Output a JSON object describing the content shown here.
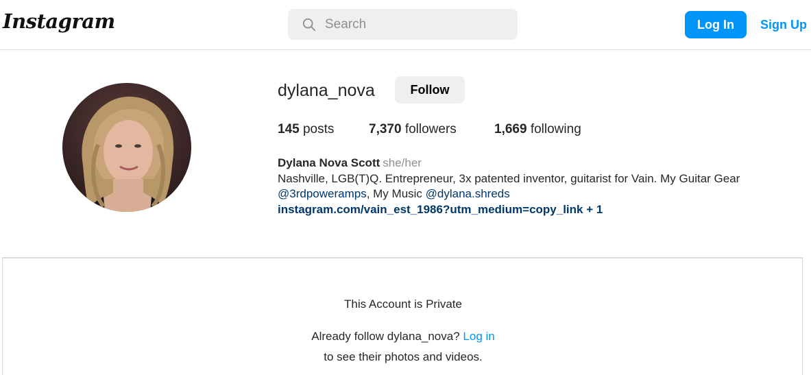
{
  "header": {
    "logo_text": "Instagram",
    "search_placeholder": "Search",
    "login_label": "Log In",
    "signup_label": "Sign Up"
  },
  "profile": {
    "username": "dylana_nova",
    "follow_label": "Follow",
    "stats": {
      "posts_count": "145",
      "posts_label": "posts",
      "followers_count": "7,370",
      "followers_label": "followers",
      "following_count": "1,669",
      "following_label": "following"
    },
    "full_name": "Dylana Nova Scott",
    "pronouns": "she/her",
    "bio_line1": "Nashville, LGB(T)Q. Entrepreneur, 3x patented inventor, guitarist for Vain. My Guitar Gear",
    "mention1": "@3rdpoweramps",
    "bio_mid": ", My Music ",
    "mention2": "@dylana.shreds",
    "link": "instagram.com/vain_est_1986?utm_medium=copy_link + 1"
  },
  "private": {
    "title": "This Account is Private",
    "already_follow": "Already follow dylana_nova?",
    "login_link": "Log in",
    "see_text": "to see their photos and videos."
  },
  "colors": {
    "accent": "#0095f6",
    "link_dark": "#00376b",
    "text": "#262626",
    "muted": "#8e8e8e",
    "button_gray": "#efefef",
    "border": "#dbdbdb"
  },
  "icons": {
    "search": "search-icon",
    "avatar": "profile-photo"
  }
}
